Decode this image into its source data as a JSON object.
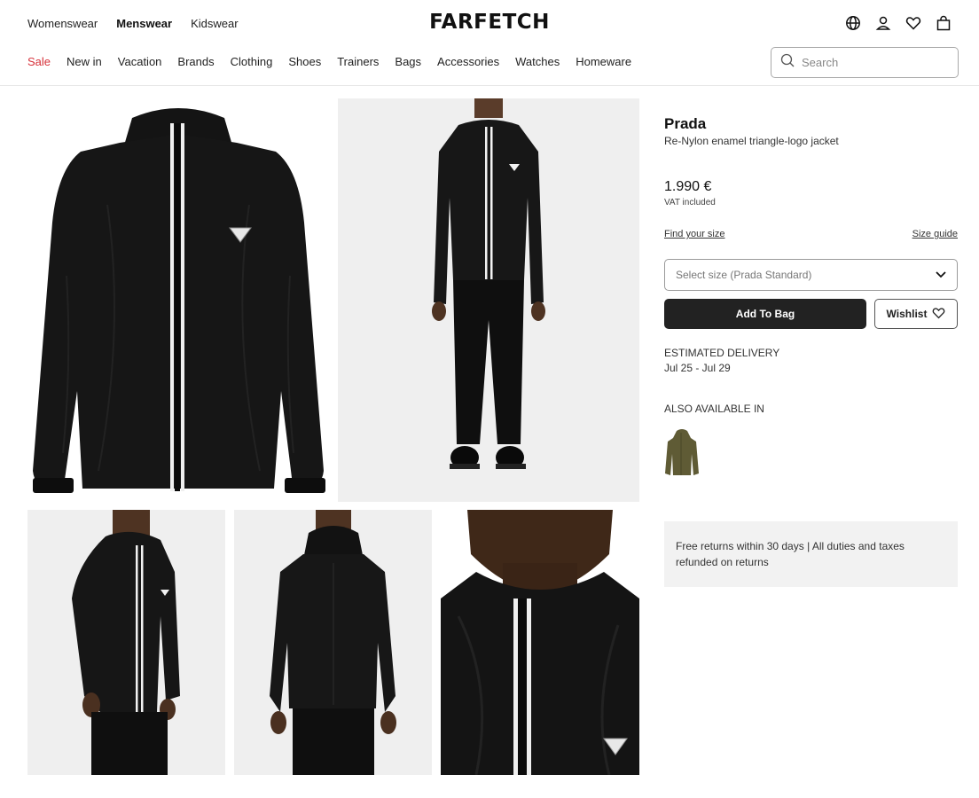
{
  "header": {
    "gender_tabs": [
      {
        "label": "Womenswear",
        "active": false
      },
      {
        "label": "Menswear",
        "active": true
      },
      {
        "label": "Kidswear",
        "active": false
      }
    ],
    "logo": "FARFETCH",
    "icons": [
      "globe-icon",
      "account-icon",
      "wishlist-heart-icon",
      "shopping-bag-icon"
    ]
  },
  "categories": [
    "Sale",
    "New in",
    "Vacation",
    "Brands",
    "Clothing",
    "Shoes",
    "Trainers",
    "Bags",
    "Accessories",
    "Watches",
    "Homeware"
  ],
  "search": {
    "placeholder": "Search",
    "icon": "search-icon"
  },
  "gallery": {
    "images": [
      "jacket-front-flatlay",
      "model-full-length-front",
      "model-three-quarter-side",
      "model-back-view",
      "collar-closeup"
    ]
  },
  "product": {
    "brand": "Prada",
    "name": "Re-Nylon enamel triangle-logo jacket",
    "price": "1.990 €",
    "vat_note": "VAT included",
    "find_size": "Find your size",
    "size_guide": "Size guide",
    "size_select": "Select size (Prada Standard)",
    "add_to_bag": "Add To Bag",
    "wishlist": "Wishlist",
    "delivery_label": "ESTIMATED DELIVERY",
    "delivery_dates": "Jul 25 - Jul 29",
    "also_available_label": "ALSO AVAILABLE IN",
    "also_available_colors": [
      "#5f5b35"
    ],
    "returns_text": "Free returns within 30 days | All duties and taxes refunded on returns"
  },
  "colors": {
    "sale": "#d6313a",
    "primary_button": "#222222",
    "jacket": "#151515",
    "photo_bg": "#efefef"
  }
}
